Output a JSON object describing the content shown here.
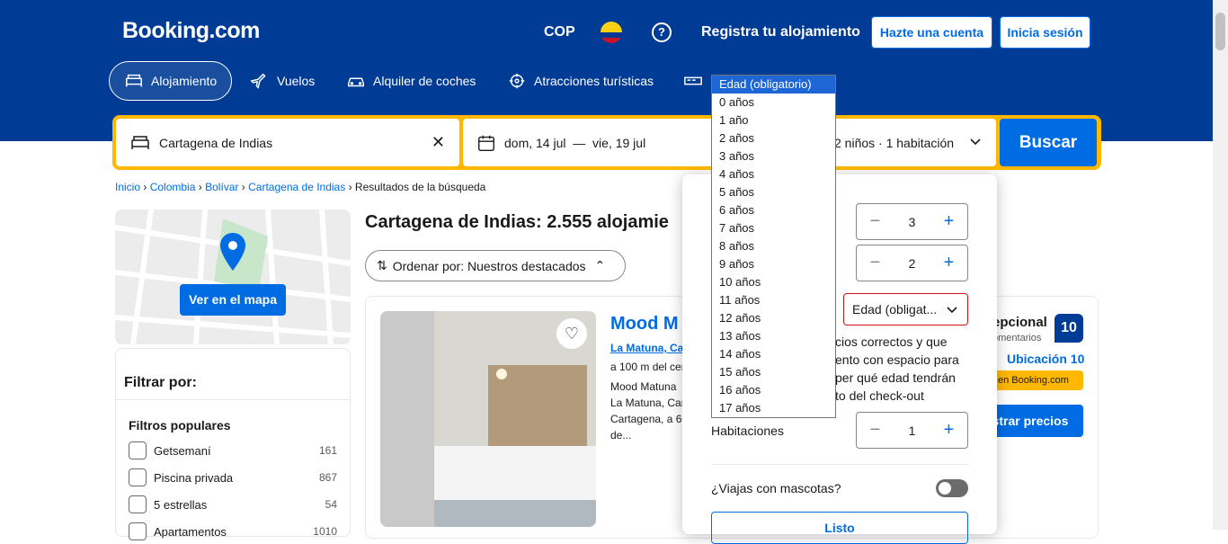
{
  "header": {
    "logo": "Booking.com",
    "currency": "COP",
    "help_icon": "?",
    "register_property": "Registra tu alojamiento",
    "create_account": "Hazte una cuenta",
    "sign_in": "Inicia sesión"
  },
  "nav": [
    {
      "label": "Alojamiento",
      "icon": "bed-icon"
    },
    {
      "label": "Vuelos",
      "icon": "plane-icon"
    },
    {
      "label": "Alquiler de coches",
      "icon": "car-icon"
    },
    {
      "label": "Atracciones turísticas",
      "icon": "attractions-icon"
    }
  ],
  "search": {
    "destination": "Cartagena de Indias",
    "dates": "dom, 14 jul  —  vie, 19 jul",
    "occupancy": "2 niños · 1 habitación",
    "button": "Buscar"
  },
  "breadcrumb": [
    "Inicio",
    "Colombia",
    "Bolívar",
    "Cartagena de Indias",
    "Resultados de la búsqueda"
  ],
  "map": {
    "button": "Ver en el mapa"
  },
  "filters": {
    "title": "Filtrar por:",
    "popular_title": "Filtros populares",
    "items": [
      {
        "label": "Getsemaní",
        "count": "161"
      },
      {
        "label": "Piscina privada",
        "count": "867"
      },
      {
        "label": "5 estrellas",
        "count": "54"
      },
      {
        "label": "Apartamentos",
        "count": "1010"
      }
    ]
  },
  "results": {
    "title": "Cartagena de Indias: 2.555 alojamie",
    "sort": "Ordenar por: Nuestros destacados"
  },
  "hotel": {
    "name": "Mood M",
    "location_link": "La Matuna, Car",
    "distance": "a 100 m del cen",
    "desc_1": "Mood Matuna",
    "desc_2": "La Matuna, Car",
    "desc_3": "Cartagena, a 60",
    "desc_4": "de...",
    "review_label": "epcional",
    "review_count": "omentarios",
    "score": "10",
    "location_score": "Ubicación 10",
    "badge": "en Booking.com",
    "show_prices": "ostrar precios"
  },
  "occupancy_popup": {
    "adults_value": "3",
    "children_value": "2",
    "age_select": "Edad (obligat...",
    "note_1": "cios correctos y que",
    "note_2": "ento con espacio para",
    "note_3": "per qué edad tendrán",
    "note_4": "to del check-out",
    "rooms_label": "Habitaciones",
    "rooms_value": "1",
    "pets_label": "¿Viajas con mascotas?",
    "done": "Listo"
  },
  "age_dropdown": {
    "selected": "Edad (obligatorio)",
    "options": [
      "0 años",
      "1 año",
      "2 años",
      "3 años",
      "4 años",
      "5 años",
      "6 años",
      "7 años",
      "8 años",
      "9 años",
      "10 años",
      "11 años",
      "12 años",
      "13 años",
      "14 años",
      "15 años",
      "16 años",
      "17 años"
    ]
  },
  "colors": {
    "brand": "#003b95",
    "accent": "#006ce4",
    "search_border": "#ffb700",
    "badge": "#ffb700"
  }
}
